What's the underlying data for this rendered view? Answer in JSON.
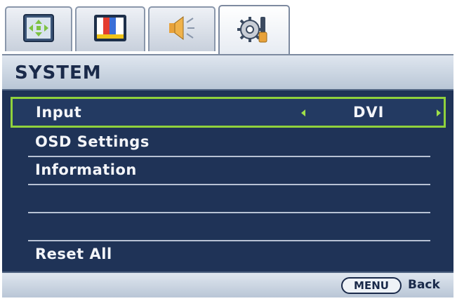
{
  "tabs": [
    {
      "icon": "display-adjust-icon",
      "active": false
    },
    {
      "icon": "picture-icon",
      "active": false
    },
    {
      "icon": "audio-speaker-icon",
      "active": false
    },
    {
      "icon": "system-settings-icon",
      "active": true
    }
  ],
  "header": {
    "title": "SYSTEM"
  },
  "menu": {
    "items": [
      {
        "label": "Input",
        "value": "DVI",
        "selected": true
      },
      {
        "label": "OSD Settings"
      },
      {
        "label": "Information"
      },
      {
        "label": ""
      },
      {
        "label": ""
      },
      {
        "label": "Reset All"
      }
    ]
  },
  "footer": {
    "menu_button": "MENU",
    "back_label": "Back"
  },
  "colors": {
    "menu_background": "#1f3357",
    "selection_border": "#8fd13c",
    "text": "#f3f5f9"
  }
}
